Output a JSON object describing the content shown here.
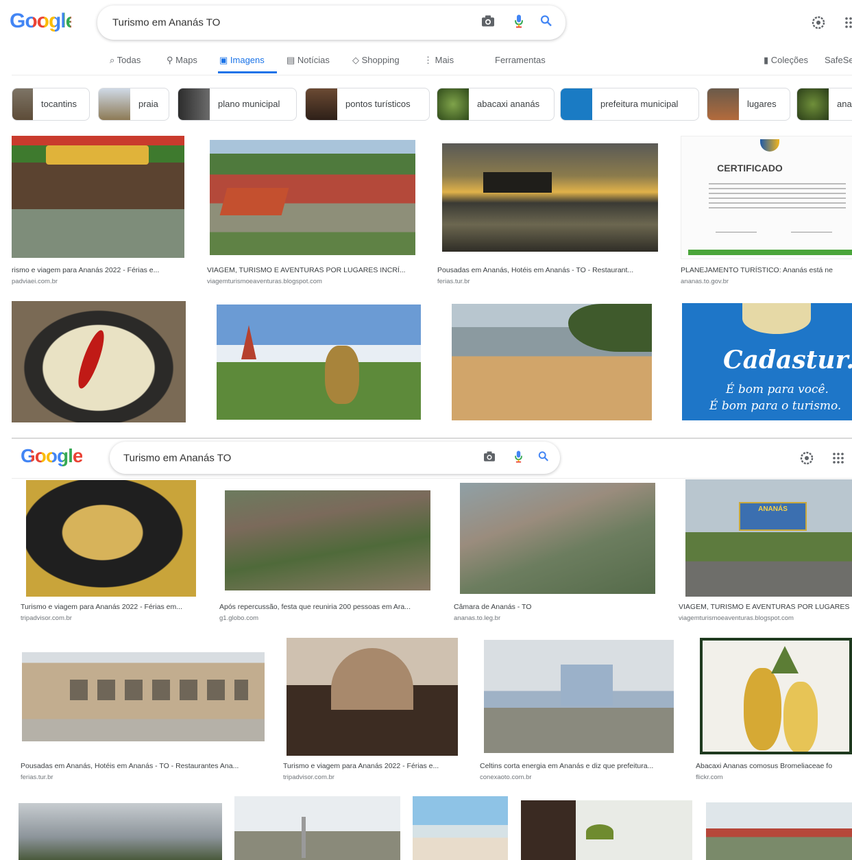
{
  "top": {
    "logo": "Google",
    "query": "Turismo em Ananás TO",
    "tabs": [
      "Todas",
      "Maps",
      "Imagens",
      "Notícias",
      "Shopping",
      "Mais"
    ],
    "tools": "Ferramentas",
    "collections": "Coleções",
    "safesearch": "SafeSe",
    "chips": [
      "tocantins",
      "praia",
      "plano municipal",
      "pontos turísticos",
      "abacaxi ananás",
      "prefeitura municipal",
      "lugares",
      "ana"
    ],
    "row1": [
      {
        "caption": "rismo e viagem para Ananás 2022 - Férias e...",
        "source": "padviaei.com.br"
      },
      {
        "caption": "VIAGEM, TURISMO E AVENTURAS POR LUGARES INCRÍ...",
        "source": "viagemturismoeaventuras.blogspot.com"
      },
      {
        "caption": "Pousadas em Ananás, Hotéis em Ananás - TO - Restaurant...",
        "source": "ferias.tur.br"
      },
      {
        "caption": "PLANEJAMENTO TURÍSTICO: Ananás está ne",
        "source": "ananas.to.gov.br"
      }
    ],
    "certificate_title": "CERTIFICADO",
    "cadastur_title": "Cadastur.",
    "cadastur_line1": "É bom para você.",
    "cadastur_line2": "É bom para o turismo."
  },
  "bottom": {
    "logo": "Google",
    "query": "Turismo em Ananás TO",
    "row1": [
      {
        "caption": "Turismo e viagem para Ananás 2022 - Férias em...",
        "source": "tripadvisor.com.br"
      },
      {
        "caption": "Após repercussão, festa que reuniria 200 pessoas em Ara...",
        "source": "g1.globo.com"
      },
      {
        "caption": "Câmara de Ananás - TO",
        "source": "ananas.to.leg.br"
      },
      {
        "caption": "VIAGEM, TURISMO E AVENTURAS POR LUGARES",
        "source": "viagemturismoeaventuras.blogspot.com"
      }
    ],
    "billboard_text": "ANANÁS",
    "row2": [
      {
        "caption": "Pousadas em Ananás, Hotéis em Ananás - TO - Restaurantes Ana...",
        "source": "ferias.tur.br"
      },
      {
        "caption": "Turismo e viagem para Ananás 2022 - Férias e...",
        "source": "tripadvisor.com.br"
      },
      {
        "caption": "Celtins corta energia em Ananás e diz que prefeitura...",
        "source": "conexaoto.com.br"
      },
      {
        "caption": "Abacaxi Ananas comosus Bromeliaceae fo",
        "source": "flickr.com"
      }
    ]
  }
}
